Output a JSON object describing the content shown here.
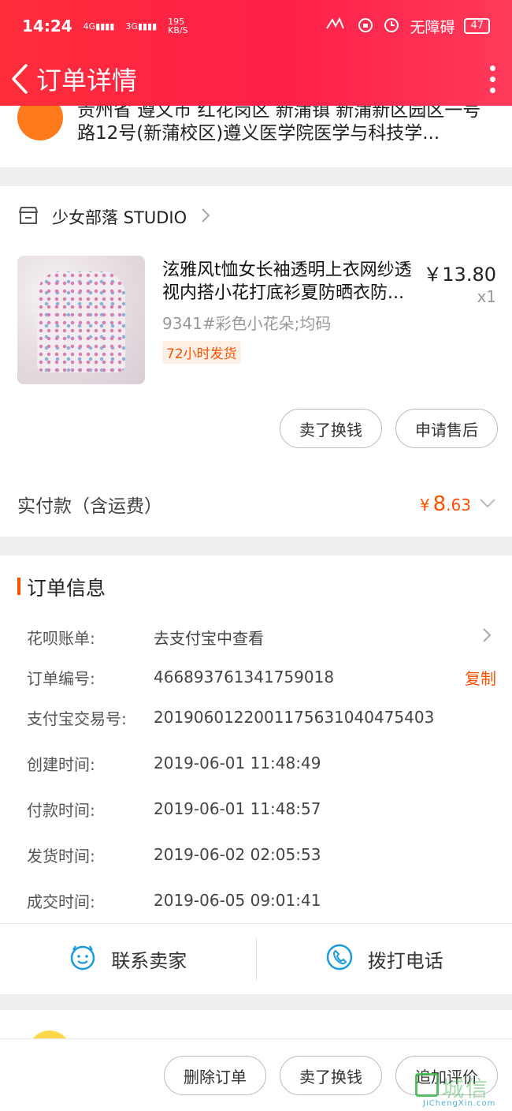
{
  "status_bar": {
    "time": "14:24",
    "signal_left": "4G",
    "signal_right": "3G",
    "net_speed": "195",
    "net_unit": "KB/S",
    "accessibility": "无障碍",
    "battery": "47"
  },
  "nav": {
    "title": "订单详情",
    "back_icon": "chevron-left-icon",
    "more_icon": "more-vertical-icon"
  },
  "address": {
    "text": "贵州省 遵义市 红花岗区 新蒲镇 新蒲新区园区一号路12号(新蒲校区)遵义医学院医学与科技学..."
  },
  "shop": {
    "name": "少女部落 STUDIO",
    "icon": "store-icon"
  },
  "product": {
    "title": "泫雅风t恤女长袖透明上衣网纱透视内搭小花打底衫夏防晒衣防...",
    "price": "￥13.80",
    "quantity": "x1",
    "sku": "9341#彩色小花朵;均码",
    "badge": "72小时发货"
  },
  "item_actions": {
    "sell_exchange": "卖了换钱",
    "after_sale": "申请售后"
  },
  "payment": {
    "label": "实付款（含运费）",
    "symbol": "¥",
    "integer": "8",
    "decimal": ".63"
  },
  "order_info": {
    "title": "订单信息",
    "huabei_label": "花呗账单:",
    "huabei_value": "去支付宝中查看",
    "order_no_label": "订单编号:",
    "order_no_value": "466893761341759018",
    "copy_label": "复制",
    "alipay_no_label": "支付宝交易号:",
    "alipay_no_value": "2019060122001175631040475403",
    "created_label": "创建时间:",
    "created_value": "2019-06-01 11:48:49",
    "paid_label": "付款时间:",
    "paid_value": "2019-06-01 11:48:57",
    "shipped_label": "发货时间:",
    "shipped_value": "2019-06-02 02:05:53",
    "completed_label": "成交时间:",
    "completed_value": "2019-06-05 09:01:41"
  },
  "contact": {
    "seller_label": "联系卖家",
    "call_label": "拨打电话"
  },
  "bottom_bar": {
    "delete_order": "删除订单",
    "sell_exchange": "卖了换钱",
    "add_review": "追加评价"
  },
  "watermark": {
    "text": "城信",
    "sub": "JiChengXin.com"
  },
  "colors": {
    "header_red": "#ff2d3a",
    "accent_orange": "#ff5000",
    "contact_blue": "#1a9be0"
  }
}
